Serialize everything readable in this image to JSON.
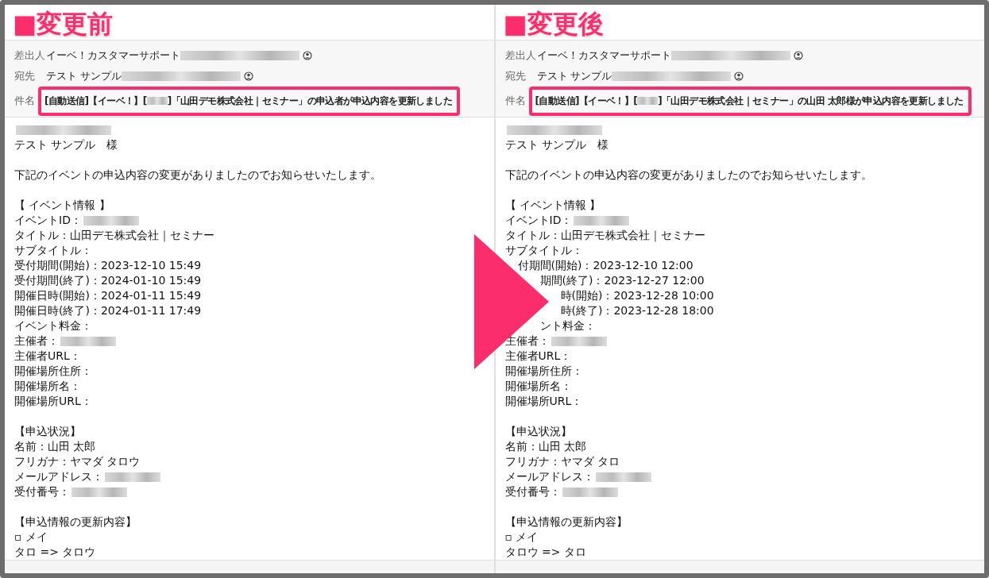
{
  "panels": [
    {
      "label": "■変更前",
      "from_label": "差出人",
      "from": "イーベ！カスタマーサポート",
      "to_label": "宛先",
      "to": "テスト サンプル",
      "subject_label": "件名",
      "subject_before": "[自動送信]【イーベ！】[",
      "subject_after": "]「山田デモ株式会社｜セミナー」の申込者が申込内容を更新しました",
      "paragraphs": [
        {
          "lines": [
            {
              "redacted": true
            },
            {
              "text": "テスト サンプル　様",
              "redacted": false
            }
          ]
        },
        {
          "lines": [
            {
              "text": "下記のイベントの申込内容の変更がありましたのでお知らせいたします。",
              "redacted": false
            }
          ]
        },
        {
          "lines": [
            {
              "text": "【 イベント情報 】",
              "redacted": false
            },
            {
              "text": "イベントID：",
              "redacted": true
            },
            {
              "text": "タイトル：山田デモ株式会社｜セミナー",
              "redacted": false
            },
            {
              "text": "サブタイトル：",
              "redacted": false
            },
            {
              "text": "受付期間(開始)：2023-12-10 15:49",
              "redacted": false
            },
            {
              "text": "受付期間(終了)：2024-01-10 15:49",
              "redacted": false
            },
            {
              "text": "開催日時(開始)：2024-01-11 15:49",
              "redacted": false
            },
            {
              "text": "開催日時(終了)：2024-01-11 17:49",
              "redacted": false
            },
            {
              "text": "イベント料金：",
              "redacted": false
            },
            {
              "text": "主催者：",
              "redacted": true
            },
            {
              "text": "主催者URL：",
              "redacted": false
            },
            {
              "text": "開催場所住所：",
              "redacted": false
            },
            {
              "text": "開催場所名：",
              "redacted": false
            },
            {
              "text": "開催場所URL：",
              "redacted": false
            }
          ]
        },
        {
          "lines": [
            {
              "text": "【申込状況】",
              "redacted": false
            },
            {
              "text": "名前：山田 太郎",
              "redacted": false
            },
            {
              "text": "フリガナ：ヤマダ タロウ",
              "redacted": false
            },
            {
              "text": "メールアドレス：",
              "redacted": true
            },
            {
              "text": "受付番号：",
              "redacted": true
            }
          ]
        },
        {
          "lines": [
            {
              "text": "【申込情報の更新内容】",
              "redacted": false
            },
            {
              "text": "▫ メイ",
              "redacted": false
            },
            {
              "text": "タロ => タロウ",
              "redacted": false
            }
          ]
        }
      ]
    },
    {
      "label": "■変更後",
      "from_label": "差出人",
      "from": "イーベ！カスタマーサポート",
      "to_label": "宛先",
      "to": "テスト サンプル",
      "subject_label": "件名",
      "subject_before": "[自動送信]【イーベ！】[",
      "subject_after": "]「山田デモ株式会社｜セミナー」の山田 太郎様が申込内容を更新しました",
      "paragraphs": [
        {
          "lines": [
            {
              "redacted": true
            },
            {
              "text": "テスト サンプル　様",
              "redacted": false
            }
          ]
        },
        {
          "lines": [
            {
              "text": "下記のイベントの申込内容の変更がありましたのでお知らせいたします。",
              "redacted": false
            }
          ]
        },
        {
          "lines": [
            {
              "text": "【 イベント情報 】",
              "redacted": false
            },
            {
              "text": "イベントID：",
              "redacted": true
            },
            {
              "text": "タイトル：山田デモ株式会社｜セミナー",
              "redacted": false
            },
            {
              "text": "サブタイトル：",
              "redacted": false
            },
            {
              "text": "付期間(開始)：2023-12-10 12:00",
              "redacted": false
            },
            {
              "text": "期間(終了)：2023-12-27 12:00",
              "redacted": false
            },
            {
              "text": "時(開始)：2023-12-28 10:00",
              "redacted": false
            },
            {
              "text": "時(終了)：2023-12-28 18:00",
              "redacted": false
            },
            {
              "text": "ント料金：",
              "redacted": false
            },
            {
              "text": "主催者：",
              "redacted": true
            },
            {
              "text": "主催者URL：",
              "redacted": false
            },
            {
              "text": "開催場所住所：",
              "redacted": false
            },
            {
              "text": "開催場所名：",
              "redacted": false
            },
            {
              "text": "開催場所URL：",
              "redacted": false
            }
          ]
        },
        {
          "lines": [
            {
              "text": "【申込状況】",
              "redacted": false
            },
            {
              "text": "名前：山田 太郎",
              "redacted": false
            },
            {
              "text": "フリガナ：ヤマダ タロ",
              "redacted": false
            },
            {
              "text": "メールアドレス：",
              "redacted": true
            },
            {
              "text": "受付番号：",
              "redacted": true
            }
          ]
        },
        {
          "lines": [
            {
              "text": "【申込情報の更新内容】",
              "redacted": false
            },
            {
              "text": "▫ メイ",
              "redacted": false
            },
            {
              "text": "タロウ => タロ",
              "redacted": false
            }
          ]
        }
      ]
    }
  ]
}
